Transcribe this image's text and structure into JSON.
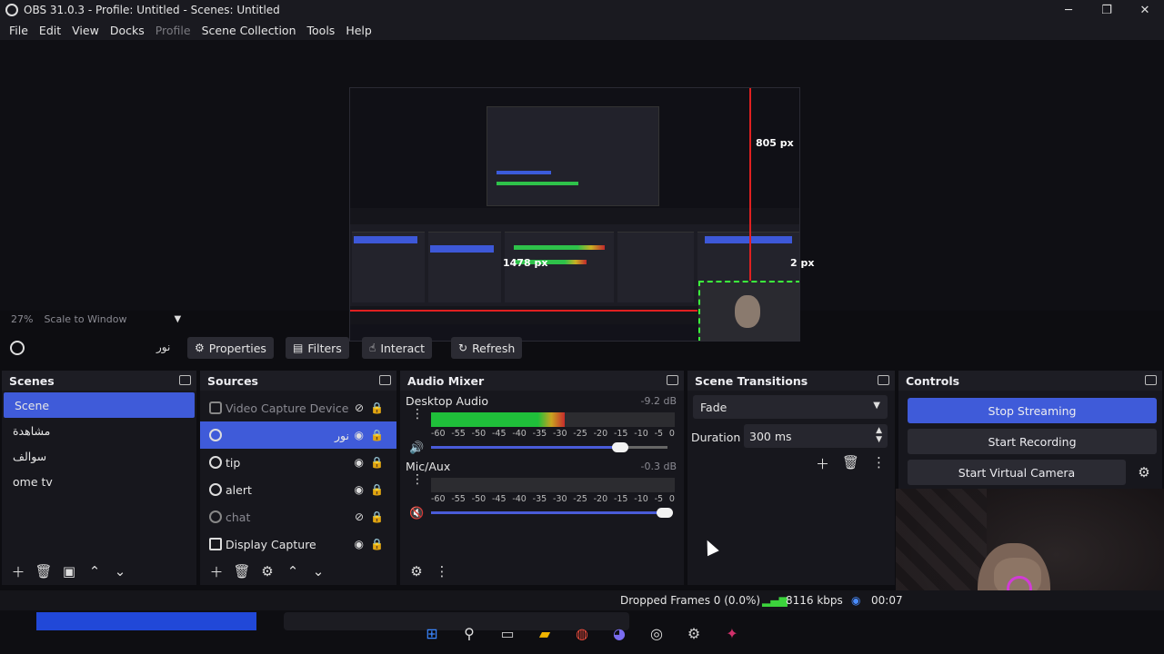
{
  "window": {
    "title": "OBS 31.0.3 - Profile: Untitled - Scenes: Untitled",
    "minimize": "─",
    "maximize": "❐",
    "close": "✕"
  },
  "menu": [
    "File",
    "Edit",
    "View",
    "Docks",
    "Profile",
    "Scene Collection",
    "Tools",
    "Help"
  ],
  "preview": {
    "measure_top": "805 px",
    "measure_bottom": "1478 px",
    "measure_right": "2 px"
  },
  "zoom": {
    "percent": "27%",
    "mode": "Scale to Window"
  },
  "source_toolbar": {
    "selected_source": "نور",
    "properties": "Properties",
    "filters": "Filters",
    "interact": "Interact",
    "refresh": "Refresh"
  },
  "scenes": {
    "title": "Scenes",
    "items": [
      "Scene",
      "مشاهدة",
      "سوالف",
      "ome tv"
    ]
  },
  "sources": {
    "title": "Sources",
    "items": [
      {
        "label": "Video Capture Device",
        "hidden": true
      },
      {
        "label": "نور",
        "hidden": false
      },
      {
        "label": "tip",
        "hidden": false
      },
      {
        "label": "alert",
        "hidden": false
      },
      {
        "label": "chat",
        "hidden": true
      },
      {
        "label": "Display Capture",
        "hidden": false
      }
    ]
  },
  "audio_mixer": {
    "title": "Audio Mixer",
    "channels": [
      {
        "name": "Desktop Audio",
        "db": "-9.2 dB",
        "level": 0.55,
        "volume": 0.8
      },
      {
        "name": "Mic/Aux",
        "db": "-0.3 dB",
        "level": 0.0,
        "volume": 0.99
      }
    ],
    "scale": [
      "-60",
      "-55",
      "-50",
      "-45",
      "-40",
      "-35",
      "-30",
      "-25",
      "-20",
      "-15",
      "-10",
      "-5",
      "0"
    ]
  },
  "scene_transitions": {
    "title": "Scene Transitions",
    "transition": "Fade",
    "duration_label": "Duration",
    "duration_value": "300 ms"
  },
  "controls": {
    "title": "Controls",
    "stop_streaming": "Stop Streaming",
    "start_recording": "Start Recording",
    "start_virtual_camera": "Start Virtual Camera"
  },
  "status": {
    "dropped_frames": "Dropped Frames 0 (0.0%)",
    "bitrate": "8116 kbps",
    "time": "00:07"
  },
  "colors": {
    "accent": "#3f5bd9",
    "background": "#17171d"
  }
}
